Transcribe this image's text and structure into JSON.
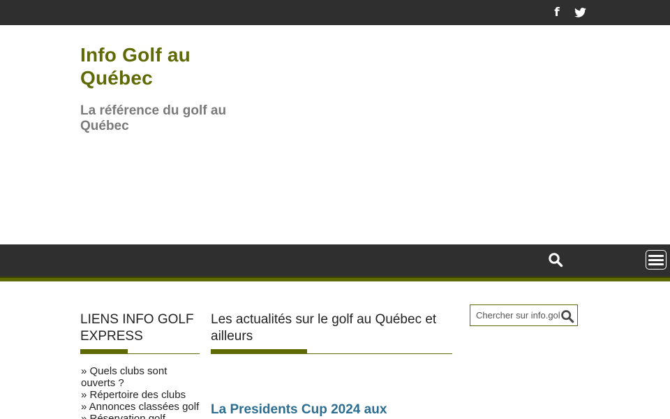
{
  "topbar": {
    "facebook_glyph": "f",
    "icons": [
      "facebook-icon",
      "twitter-icon"
    ],
    "color": "#2f2f2f"
  },
  "header": {
    "site_title": "Info Golf au Québec",
    "tagline": "La référence du golf au Québec"
  },
  "nav": {
    "icons": [
      "search-icon",
      "menu-icon"
    ],
    "accent_color": "#5f6a04"
  },
  "sidebar_left": {
    "title": "LIENS INFO GOLF EXPRESS",
    "links": [
      "» Quels clubs sont ouverts ?",
      "» Répertoire des clubs",
      "» Annonces classées golf",
      "» Réservation golf"
    ]
  },
  "main": {
    "title": "Les actualités sur le golf au Québec et ailleurs",
    "post_title": "La Presidents Cup 2024 aux"
  },
  "sidebar_right": {
    "search_placeholder": "Chercher sur info.golf",
    "search_icon": "search-icon"
  },
  "colors": {
    "brand": "#5f6a04",
    "dark_bar": "#2f2f2f",
    "link_blue": "#2c6e91",
    "tagline_gray": "#7a7a7a"
  }
}
